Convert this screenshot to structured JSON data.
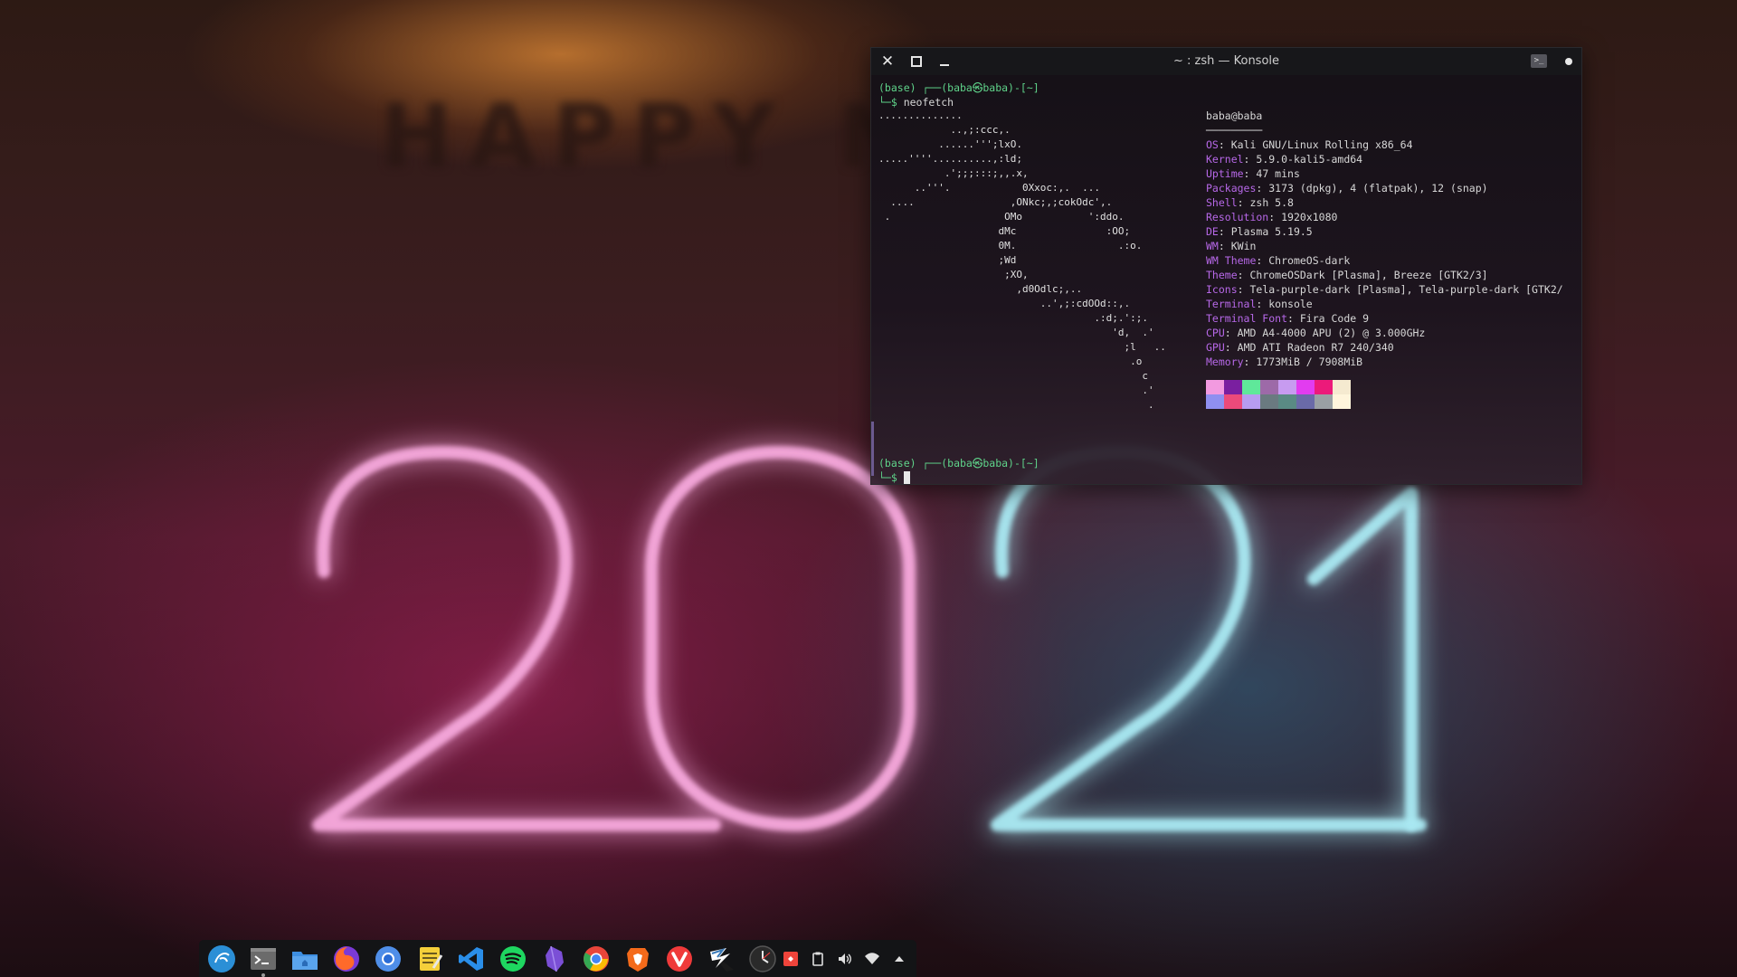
{
  "wallpaper": {
    "wall_text": "HAPPY N"
  },
  "konsole": {
    "title": "~ : zsh — Konsole",
    "prompt1": "(base) ┌──(baba㉿baba)-[~]",
    "cmd_prefix": "└─$ ",
    "command": "neofetch",
    "prompt2": "(base) ┌──(baba㉿baba)-[~]",
    "prompt2_tail": "└─$ ",
    "ascii_art": "..............\n            ..,;:ccc,.\n          ......''';lxO.\n.....''''..........,:ld;\n           .';;;:::;,,.x,\n      ..'''.            0Xxoc:,.  ...\n  ....                ,ONkc;,;cokOdc',.\n .                   OMo           ':ddo.\n                    dMc               :OO;\n                    0M.                 .:o.\n                    ;Wd\n                     ;XO,\n                       ,d0Odlc;,..\n                           ..',;:cdOOd::,.\n                                    .:d;.':;.\n                                       'd,  .'\n                                         ;l   ..\n                                          .o\n                                            c\n                                            .'\n                                             .",
    "user_host": "baba@baba",
    "separator": "─────────",
    "info": [
      {
        "key": "OS",
        "value": "Kali GNU/Linux Rolling x86_64"
      },
      {
        "key": "Kernel",
        "value": "5.9.0-kali5-amd64"
      },
      {
        "key": "Uptime",
        "value": "47 mins"
      },
      {
        "key": "Packages",
        "value": "3173 (dpkg), 4 (flatpak), 12 (snap)"
      },
      {
        "key": "Shell",
        "value": "zsh 5.8"
      },
      {
        "key": "Resolution",
        "value": "1920x1080"
      },
      {
        "key": "DE",
        "value": "Plasma 5.19.5"
      },
      {
        "key": "WM",
        "value": "KWin"
      },
      {
        "key": "WM Theme",
        "value": "ChromeOS-dark"
      },
      {
        "key": "Theme",
        "value": "ChromeOSDark [Plasma], Breeze [GTK2/3]"
      },
      {
        "key": "Icons",
        "value": "Tela-purple-dark [Plasma], Tela-purple-dark [GTK2/"
      },
      {
        "key": "Terminal",
        "value": "konsole"
      },
      {
        "key": "Terminal Font",
        "value": "Fira Code 9"
      },
      {
        "key": "CPU",
        "value": "AMD A4-4000 APU (2) @ 3.000GHz"
      },
      {
        "key": "GPU",
        "value": "AMD ATI Radeon R7 240/340"
      },
      {
        "key": "Memory",
        "value": "1773MiB / 7908MiB"
      }
    ],
    "palette_top": [
      "#f29ae0",
      "#7a1fa0",
      "#5fe89a",
      "#9d6aa8",
      "#c79bf0",
      "#e23cf0",
      "#ec1a7a",
      "#f5ead0"
    ],
    "palette_bottom": [
      "#8f8ff0",
      "#ec4a7a",
      "#b79cf0",
      "#6a7a80",
      "#5a8a84",
      "#6a6aa8",
      "#9aa0a4",
      "#fff5dc"
    ]
  },
  "dock": {
    "apps": [
      {
        "name": "kali-menu-icon",
        "color": "#2b8fd6"
      },
      {
        "name": "konsole-icon",
        "color": "#6b6b6b"
      },
      {
        "name": "file-manager-icon",
        "color": "#3d8ee0"
      },
      {
        "name": "firefox-icon",
        "color": "#ff6a2a"
      },
      {
        "name": "chromium-icon",
        "color": "#4f8ee8"
      },
      {
        "name": "text-editor-icon",
        "color": "#f4cf3a"
      },
      {
        "name": "vscode-icon",
        "color": "#2a8ee8"
      },
      {
        "name": "spotify-icon",
        "color": "#1ed760"
      },
      {
        "name": "obsidian-icon",
        "color": "#7b4fd6"
      },
      {
        "name": "chrome-icon",
        "color": "#e84a3a"
      },
      {
        "name": "brave-icon",
        "color": "#f46a1a"
      },
      {
        "name": "vivaldi-icon",
        "color": "#ef3a3a"
      },
      {
        "name": "kali-dragon-icon",
        "color": "#3a7ab8"
      },
      {
        "name": "clock-icon",
        "color": "#2a2a2a"
      }
    ],
    "tray": [
      {
        "name": "anydesk-tray-icon",
        "color": "#ef443b"
      },
      {
        "name": "clipboard-tray-icon",
        "color": "#e0e0e0"
      },
      {
        "name": "volume-tray-icon",
        "color": "#e0e0e0"
      },
      {
        "name": "network-tray-icon",
        "color": "#e0e0e0"
      },
      {
        "name": "tray-expand-icon",
        "color": "#e0e0e0"
      }
    ]
  }
}
